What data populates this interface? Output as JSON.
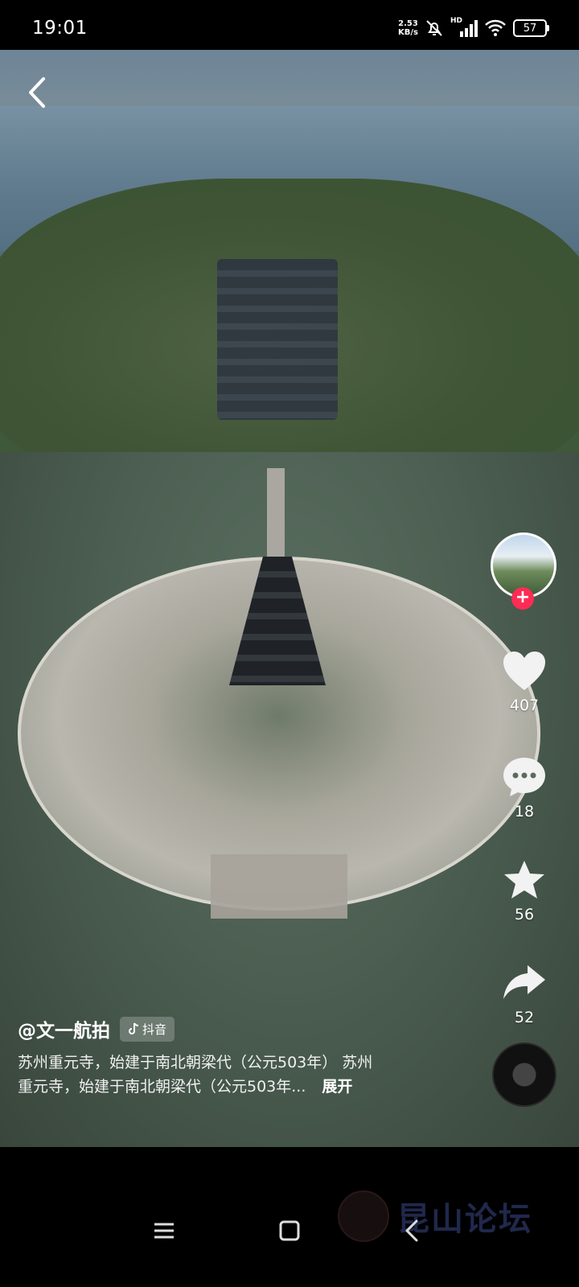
{
  "status_bar": {
    "time": "19:01",
    "net_speed_value": "2.53",
    "net_speed_unit": "KB/s",
    "network_label": "HD",
    "battery": "57",
    "icons": [
      "mute-bell-icon",
      "signal-icon",
      "wifi-icon",
      "battery-icon"
    ]
  },
  "video": {
    "back_icon": "chevron-left-icon"
  },
  "actions": {
    "follow_plus": "+",
    "like_count": "407",
    "comment_count": "18",
    "favorite_count": "56",
    "share_count": "52"
  },
  "caption": {
    "author": "@文一航拍",
    "tag": "抖音",
    "line1": "苏州重元寺，始建于南北朝梁代（公元503年） 苏州",
    "line2": "重元寺，始建于南北朝梁代（公元503年...",
    "expand": "展开"
  },
  "watermark": {
    "text": "昆山论坛"
  },
  "nav": {
    "icons": [
      "menu-icon",
      "home-square-icon",
      "back-triangle-icon"
    ]
  }
}
